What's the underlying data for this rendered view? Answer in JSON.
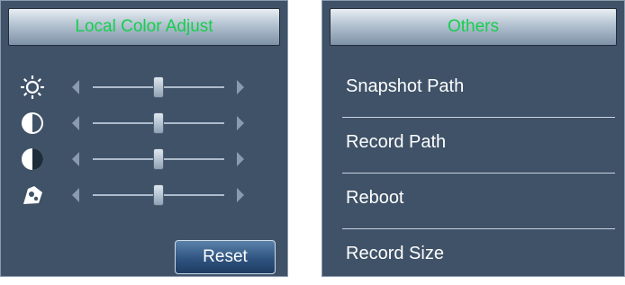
{
  "local_color_adjust": {
    "title": "Local Color Adjust",
    "sliders": [
      {
        "name": "brightness",
        "icon": "brightness-icon",
        "value": 0.5
      },
      {
        "name": "contrast",
        "icon": "contrast-icon",
        "value": 0.5
      },
      {
        "name": "saturation",
        "icon": "saturation-icon",
        "value": 0.5
      },
      {
        "name": "hue",
        "icon": "hue-icon",
        "value": 0.5
      }
    ],
    "reset_label": "Reset"
  },
  "others": {
    "title": "Others",
    "items": [
      {
        "label": "Snapshot Path"
      },
      {
        "label": "Record Path"
      },
      {
        "label": "Reboot"
      },
      {
        "label": "Record Size"
      }
    ]
  },
  "colors": {
    "panel_bg": "#3f5268",
    "title_text": "#15cf4c"
  }
}
